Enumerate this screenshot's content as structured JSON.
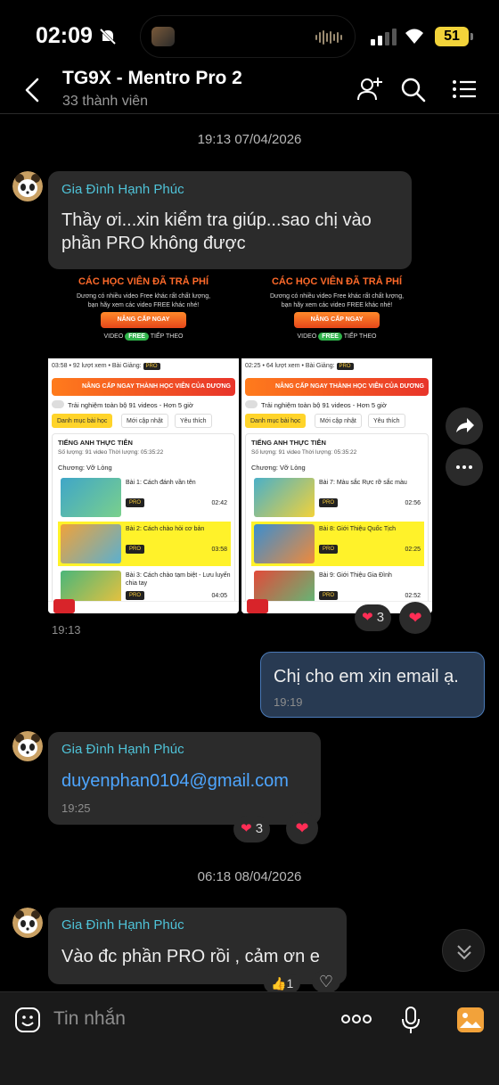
{
  "status_bar": {
    "time": "02:09",
    "battery": "51"
  },
  "header": {
    "title": "TG9X - Mentro Pro 2",
    "subtitle": "33 thành viên"
  },
  "date_separators": [
    "19:13 07/04/2026",
    "06:18 08/04/2026"
  ],
  "messages": [
    {
      "sender": "Gia Đình Hạnh Phúc",
      "text": "Thầy ơi...xin kiểm tra giúp...sao chị vào phần PRO không được"
    },
    {
      "image_time": "19:13",
      "reaction_count": "3"
    },
    {
      "text": "Chị cho em xin email ạ.",
      "time": "19:19"
    },
    {
      "sender": "Gia Đình Hạnh Phúc",
      "text": "duyenphan0104@gmail.com",
      "time": "19:25",
      "reaction_count": "3"
    },
    {
      "sender": "Gia Đình Hạnh Phúc",
      "text": "Vào đc phần PRO rồi , cảm ơn e",
      "reaction_count": "1"
    }
  ],
  "shots": [
    {
      "headline": "CÁC HỌC VIÊN ĐÃ TRẢ PHÍ",
      "sub1": "Dương có nhiều video Free khác rất chất lượng,",
      "sub2": "bạn hãy xem các video FREE khác nhé!",
      "upgrade": "NÂNG CẤP NGAY",
      "video_label": "VIDEO",
      "free_label": "FREE",
      "next_label": "TIẾP THEO",
      "stats": "03:58 • 92 lượt xem • Bài Giảng:",
      "pro": "PRO",
      "banner": "NÂNG CẤP NGAY THÀNH HỌC VIÊN CỦA DƯƠNG",
      "trial": "Trải nghiệm toàn bộ 91 videos - Hơn 5 giờ",
      "tabs": [
        "Danh mục bài học",
        "Mới cập nhật",
        "Yêu thích"
      ],
      "course": "TIẾNG ANH THỰC TIỄN",
      "meta": "Số lượng: 91 video   Thời lượng: 05:35:22",
      "chapter": "Chương: Vỡ Lòng",
      "lessons": [
        {
          "title": "Bài 1: Cách đánh vần tên",
          "duration": "02:42"
        },
        {
          "title": "Bài 2: Cách chào hỏi cơ bản",
          "duration": "03:58"
        },
        {
          "title": "Bài 3: Cách chào tạm biệt - Lưu luyến chia tay",
          "duration": "04:05"
        }
      ]
    },
    {
      "headline": "CÁC HỌC VIÊN ĐÃ TRẢ PHÍ",
      "sub1": "Dương có nhiều video Free khác rất chất lượng,",
      "sub2": "bạn hãy xem các video FREE khác nhé!",
      "upgrade": "NÂNG CẤP NGAY",
      "video_label": "VIDEO",
      "free_label": "FREE",
      "next_label": "TIẾP THEO",
      "stats": "02:25 • 64 lượt xem • Bài Giảng:",
      "pro": "PRO",
      "banner": "NÂNG CẤP NGAY THÀNH HỌC VIÊN CỦA DƯƠNG",
      "trial": "Trải nghiệm toàn bộ 91 videos - Hơn 5 giờ",
      "tabs": [
        "Danh mục bài học",
        "Mới cập nhật",
        "Yêu thích"
      ],
      "course": "TIẾNG ANH THỰC TIỄN",
      "meta": "Số lượng: 91 video   Thời lượng: 05:35:22",
      "chapter": "Chương: Vỡ Lòng",
      "lessons": [
        {
          "title": "Bài 7: Màu sắc Rực rỡ sắc màu",
          "duration": "02:56"
        },
        {
          "title": "Bài 8: Giới Thiệu Quốc Tịch",
          "duration": "02:25"
        },
        {
          "title": "Bài 9: Giới Thiệu Gia Đình",
          "duration": "02:52"
        }
      ]
    }
  ],
  "input": {
    "placeholder": "Tin nhắn"
  },
  "colors": {
    "accent": "#4fc3d8",
    "link": "#4ea6ff",
    "heart": "#ff2d55",
    "battery": "#f2d33a"
  }
}
